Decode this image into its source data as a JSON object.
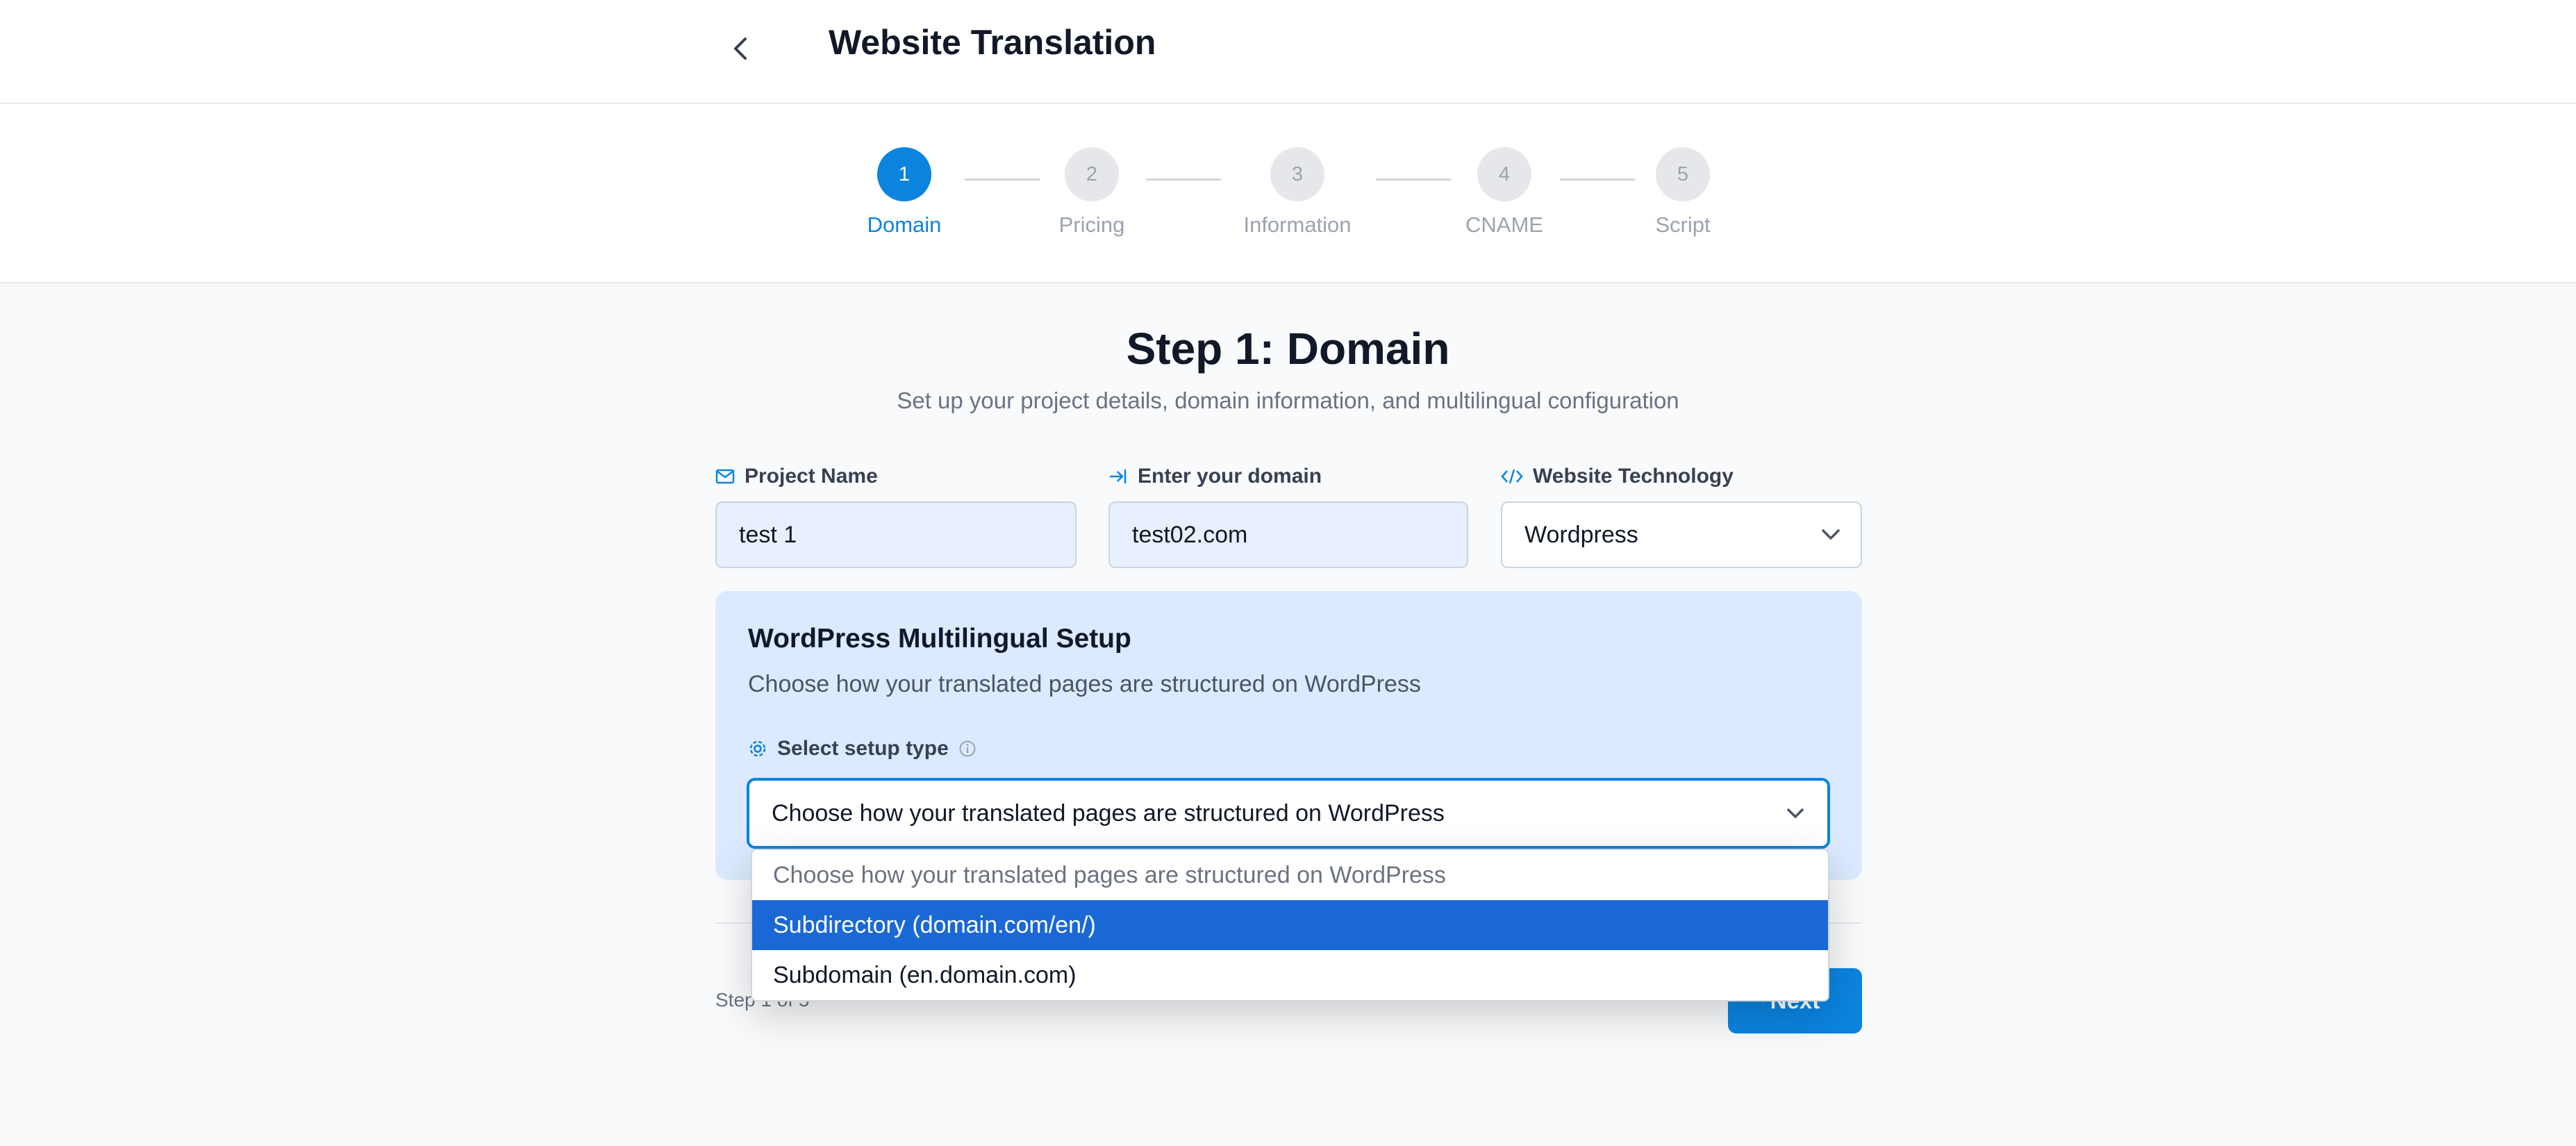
{
  "header": {
    "title": "Website Translation",
    "back_icon": "chevron-left-icon"
  },
  "stepper": {
    "active_step": 1,
    "steps": [
      {
        "number": "1",
        "label": "Domain"
      },
      {
        "number": "2",
        "label": "Pricing"
      },
      {
        "number": "3",
        "label": "Information"
      },
      {
        "number": "4",
        "label": "CNAME"
      },
      {
        "number": "5",
        "label": "Script"
      }
    ]
  },
  "main": {
    "heading": "Step 1: Domain",
    "subtitle": "Set up your project details, domain information, and multilingual configuration",
    "fields": {
      "project_name": {
        "label": "Project Name",
        "value": "test 1",
        "icon": "mail-icon"
      },
      "domain": {
        "label": "Enter your domain",
        "value": "test02.com",
        "icon": "arrow-into-icon"
      },
      "technology": {
        "label": "Website Technology",
        "value": "Wordpress",
        "icon": "code-icon"
      }
    },
    "setup": {
      "title": "WordPress Multilingual Setup",
      "description": "Choose how your translated pages are structured on WordPress",
      "select_label": "Select setup type",
      "select_value": "Choose how your translated pages are structured on WordPress",
      "options": [
        "Choose how your translated pages are structured on WordPress",
        "Subdirectory (domain.com/en/)",
        "Subdomain (en.domain.com)"
      ],
      "highlighted_option": 1
    },
    "footer": {
      "step_counter": "Step 1 of 5",
      "next_label": "Next"
    }
  },
  "colors": {
    "accent": "#0b84e0",
    "highlight": "#1a68d6",
    "panel": "#dbeafe"
  }
}
